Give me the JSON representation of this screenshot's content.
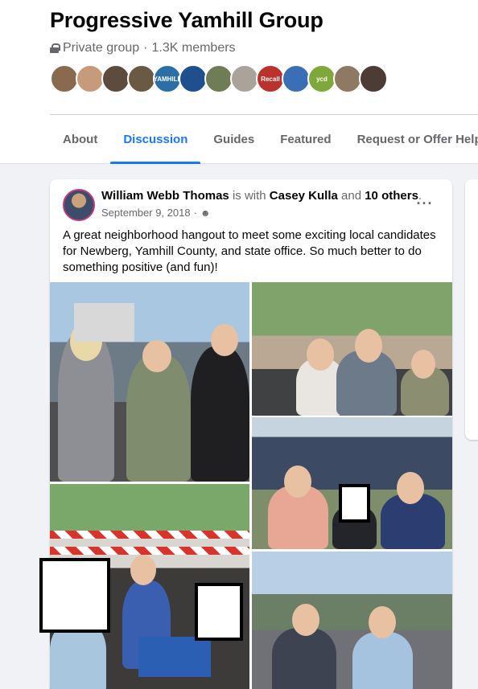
{
  "group": {
    "name": "Progressive Yamhill Group",
    "privacy": "Private group",
    "separator": "·",
    "members": "1.3K members"
  },
  "member_avatars": [
    {
      "color": "#8a6a4f",
      "label": ""
    },
    {
      "color": "#c79a7c",
      "label": ""
    },
    {
      "color": "#5d4b3e",
      "label": ""
    },
    {
      "color": "#6b5a43",
      "label": ""
    },
    {
      "color": "#2c6fa6",
      "label": "YAMHILL"
    },
    {
      "color": "#1f4f8c",
      "label": ""
    },
    {
      "color": "#6f7c55",
      "label": ""
    },
    {
      "color": "#a9a39a",
      "label": ""
    },
    {
      "color": "#b9322c",
      "label": "Recall"
    },
    {
      "color": "#3b6fb5",
      "label": ""
    },
    {
      "color": "#7fa83b",
      "label": "ycd"
    },
    {
      "color": "#8e7a63",
      "label": ""
    },
    {
      "color": "#4d3c35",
      "label": ""
    }
  ],
  "tabs": [
    {
      "label": "About",
      "active": false
    },
    {
      "label": "Discussion",
      "active": true
    },
    {
      "label": "Guides",
      "active": false
    },
    {
      "label": "Featured",
      "active": false
    },
    {
      "label": "Request or Offer Help",
      "active": false
    }
  ],
  "post": {
    "author": "William Webb Thomas",
    "with_text": " is with ",
    "tagged": "Casey Kulla",
    "and_text": " and ",
    "others": "10 others",
    "period": ".",
    "date": "September 9, 2018",
    "date_separator": "·",
    "audience_icon": "group-audience-icon",
    "more_label": "···",
    "text": "A great neighborhood hangout to meet some exciting local candidates for Newberg, Yamhill County, and state office.  So much better to do something positive (and fun)!"
  },
  "colors": {
    "accent": "#1877f2",
    "page_background": "#f0f2f5",
    "secondary_text": "#65676b"
  }
}
